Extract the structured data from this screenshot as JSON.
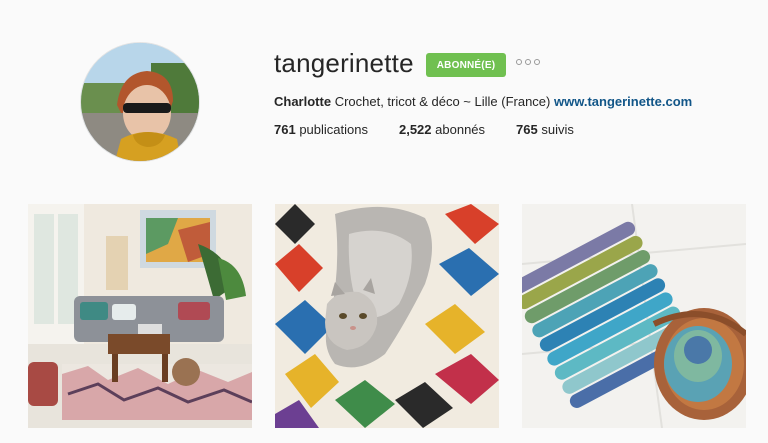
{
  "profile": {
    "username": "tangerinette",
    "follow_label": "ABONNÉ(E)",
    "bio_name": "Charlotte",
    "bio_text": "Crochet, tricot & déco ~ Lille (France)",
    "bio_link": "www.tangerinette.com",
    "stats": {
      "posts_count": "761",
      "posts_label": "publications",
      "followers_count": "2,522",
      "followers_label": "abonnés",
      "following_count": "765",
      "following_label": "suivis"
    }
  },
  "colors": {
    "follow_button": "#70c050",
    "link": "#125688",
    "background": "#fafafa"
  },
  "icons": {
    "more_options": "more-options-icon"
  },
  "photos": [
    {
      "subject": "living-room"
    },
    {
      "subject": "cat-on-rug"
    },
    {
      "subject": "knitting"
    }
  ]
}
